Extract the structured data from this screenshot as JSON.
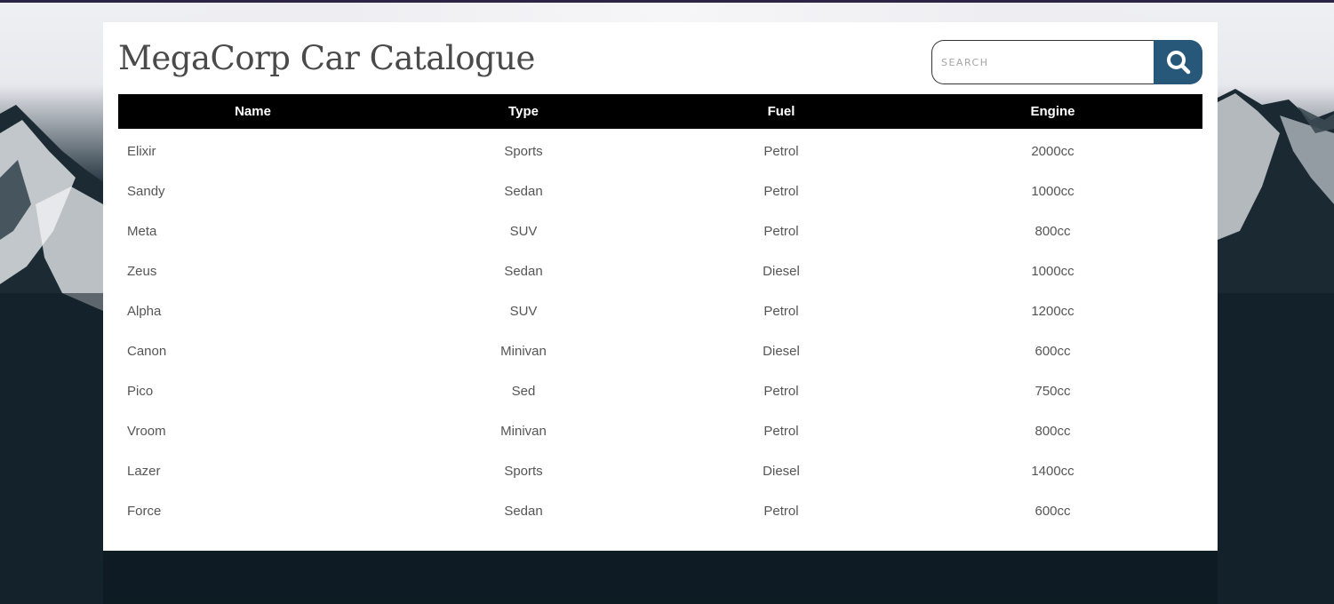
{
  "page": {
    "title": "MegaCorp Car Catalogue"
  },
  "search": {
    "placeholder": "SEARCH",
    "value": "",
    "button_icon": "search-icon",
    "button_color": "#27587a"
  },
  "table": {
    "columns": [
      "Name",
      "Type",
      "Fuel",
      "Engine"
    ],
    "rows": [
      [
        "Elixir",
        "Sports",
        "Petrol",
        "2000cc"
      ],
      [
        "Sandy",
        "Sedan",
        "Petrol",
        "1000cc"
      ],
      [
        "Meta",
        "SUV",
        "Petrol",
        "800cc"
      ],
      [
        "Zeus",
        "Sedan",
        "Diesel",
        "1000cc"
      ],
      [
        "Alpha",
        "SUV",
        "Petrol",
        "1200cc"
      ],
      [
        "Canon",
        "Minivan",
        "Diesel",
        "600cc"
      ],
      [
        "Pico",
        "Sed",
        "Petrol",
        "750cc"
      ],
      [
        "Vroom",
        "Minivan",
        "Petrol",
        "800cc"
      ],
      [
        "Lazer",
        "Sports",
        "Diesel",
        "1400cc"
      ],
      [
        "Force",
        "Sedan",
        "Petrol",
        "600cc"
      ]
    ],
    "header_bg": "#000000"
  }
}
